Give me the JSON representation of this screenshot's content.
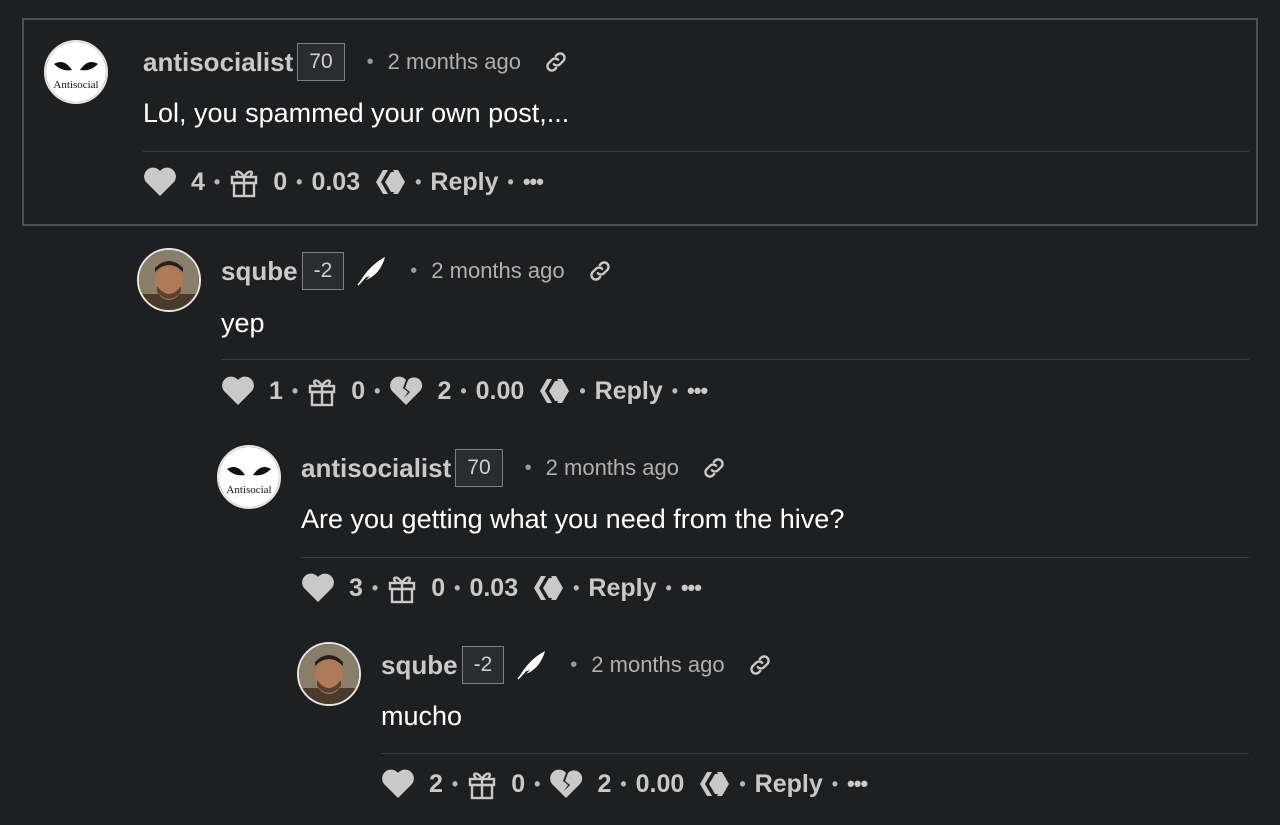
{
  "comments": [
    {
      "author": "antisocialist",
      "reputation": "70",
      "time": "2 months ago",
      "body": "Lol, you spammed your own post,...",
      "avatar_text": "Antisocial",
      "upvotes": "4",
      "gifts": "0",
      "payout": "0.03",
      "reply_label": "Reply",
      "more_label": "•••",
      "highlighted": true
    },
    {
      "author": "sqube",
      "reputation": "-2",
      "time": "2 months ago",
      "body": "yep",
      "upvotes": "1",
      "gifts": "0",
      "downvotes": "2",
      "payout": "0.00",
      "reply_label": "Reply",
      "more_label": "•••"
    },
    {
      "author": "antisocialist",
      "reputation": "70",
      "time": "2 months ago",
      "body": "Are you getting what you need from the hive?",
      "avatar_text": "Antisocial",
      "upvotes": "3",
      "gifts": "0",
      "payout": "0.03",
      "reply_label": "Reply",
      "more_label": "•••"
    },
    {
      "author": "sqube",
      "reputation": "-2",
      "time": "2 months ago",
      "body": "mucho",
      "upvotes": "2",
      "gifts": "0",
      "downvotes": "2",
      "payout": "0.00",
      "reply_label": "Reply",
      "more_label": "•••"
    }
  ],
  "icons": {
    "upvote": "heart-icon",
    "gift": "gift-icon",
    "downvote": "broken-heart-icon",
    "currency": "hive-icon",
    "permalink": "link-icon",
    "pro_badge": "feather-icon"
  },
  "colors": {
    "background": "#1e1f21",
    "text": "#f3f3f3",
    "muted": "#c9c9c9"
  }
}
